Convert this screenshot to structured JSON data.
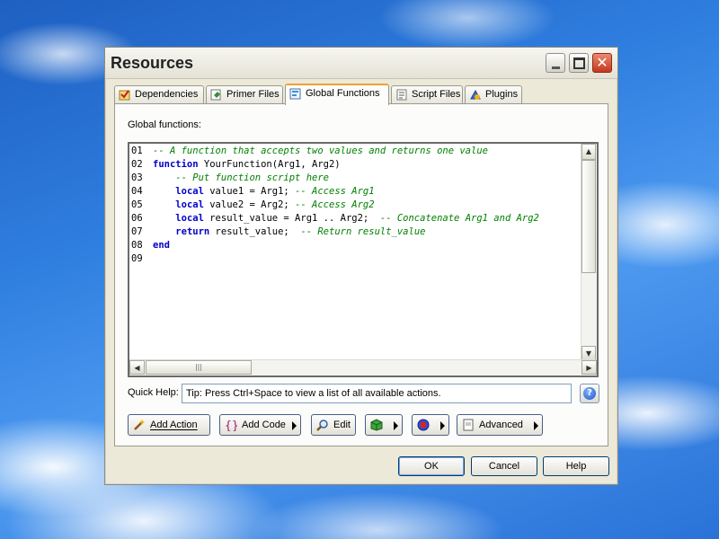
{
  "window": {
    "title": "Resources"
  },
  "tabs": [
    {
      "label": "Dependencies",
      "icon": "dependencies-icon"
    },
    {
      "label": "Primer Files",
      "icon": "primer-files-icon"
    },
    {
      "label": "Global Functions",
      "icon": "global-functions-icon",
      "active": true
    },
    {
      "label": "Script Files",
      "icon": "script-files-icon"
    },
    {
      "label": "Plugins",
      "icon": "plugins-icon"
    }
  ],
  "panel": {
    "label": "Global functions:"
  },
  "code": {
    "lines": [
      {
        "num": "01",
        "parts": [
          {
            "t": "cm",
            "v": "-- A function that accepts two values and returns one value"
          }
        ]
      },
      {
        "num": "02",
        "parts": [
          {
            "t": "kw",
            "v": "function"
          },
          {
            "t": "tx",
            "v": " YourFunction(Arg1, Arg2)"
          }
        ]
      },
      {
        "num": "03",
        "parts": [
          {
            "t": "tx",
            "v": "    "
          },
          {
            "t": "cm",
            "v": "-- Put function script here"
          }
        ]
      },
      {
        "num": "04",
        "parts": [
          {
            "t": "tx",
            "v": "    "
          },
          {
            "t": "kw",
            "v": "local"
          },
          {
            "t": "tx",
            "v": " value1 = Arg1; "
          },
          {
            "t": "cm",
            "v": "-- Access Arg1"
          }
        ]
      },
      {
        "num": "05",
        "parts": [
          {
            "t": "tx",
            "v": "    "
          },
          {
            "t": "kw",
            "v": "local"
          },
          {
            "t": "tx",
            "v": " value2 = Arg2; "
          },
          {
            "t": "cm",
            "v": "-- Access Arg2"
          }
        ]
      },
      {
        "num": "06",
        "parts": [
          {
            "t": "tx",
            "v": "    "
          },
          {
            "t": "kw",
            "v": "local"
          },
          {
            "t": "tx",
            "v": " result_value = Arg1 .. Arg2;  "
          },
          {
            "t": "cm",
            "v": "-- Concatenate Arg1 and Arg2"
          }
        ]
      },
      {
        "num": "07",
        "parts": [
          {
            "t": "tx",
            "v": "    "
          },
          {
            "t": "kw",
            "v": "return"
          },
          {
            "t": "tx",
            "v": " result_value;  "
          },
          {
            "t": "cm",
            "v": "-- Return result_value"
          }
        ]
      },
      {
        "num": "08",
        "parts": [
          {
            "t": "kw",
            "v": "end"
          }
        ]
      },
      {
        "num": "09",
        "parts": []
      }
    ]
  },
  "quick_help": {
    "label": "Quick Help:",
    "text": "Tip: Press Ctrl+Space to view a list of all available actions."
  },
  "actions": {
    "add_action": "Add Action",
    "add_code": "Add Code",
    "edit": "Edit",
    "advanced": "Advanced"
  },
  "dialog": {
    "ok": "OK",
    "cancel": "Cancel",
    "help": "Help"
  },
  "colors": {
    "keyword": "#0000c8",
    "comment": "#008000",
    "tab_highlight": "#f0a030"
  }
}
